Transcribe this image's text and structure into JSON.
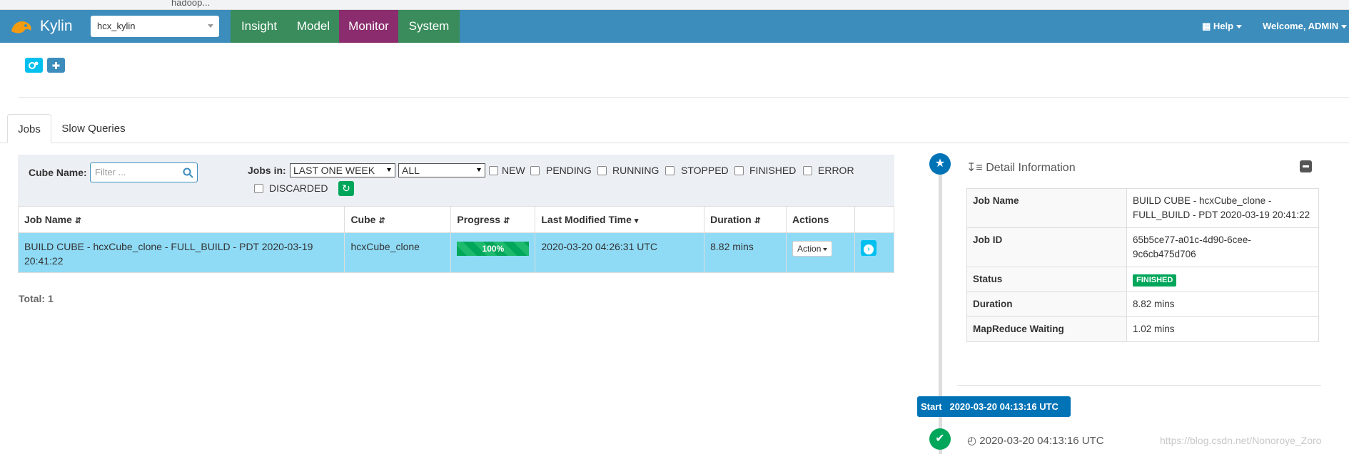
{
  "browser": {
    "address_fragment": "hadoop..."
  },
  "header": {
    "brand": "Kylin",
    "project": "hcx_kylin",
    "nav": [
      {
        "label": "Insight",
        "color": "#3a8c5c"
      },
      {
        "label": "Model",
        "color": "#3a8c5c"
      },
      {
        "label": "Monitor",
        "color": "#8b2c6e"
      },
      {
        "label": "System",
        "color": "#3a8c5c"
      }
    ],
    "help": "Help",
    "welcome": "Welcome, ADMIN"
  },
  "tabs": [
    "Jobs",
    "Slow Queries"
  ],
  "filters": {
    "cube_name_label": "Cube Name:",
    "cube_name_placeholder": "Filter ...",
    "jobs_in_label": "Jobs in:",
    "period": "LAST ONE WEEK",
    "scope": "ALL",
    "statuses": [
      "NEW",
      "PENDING",
      "RUNNING",
      "STOPPED",
      "FINISHED",
      "ERROR",
      "DISCARDED"
    ]
  },
  "table": {
    "columns": [
      "Job Name",
      "Cube",
      "Progress",
      "Last Modified Time",
      "Duration",
      "Actions"
    ],
    "rows": [
      {
        "job_name": "BUILD CUBE - hcxCube_clone - FULL_BUILD - PDT 2020-03-19 20:41:22",
        "cube": "hcxCube_clone",
        "progress": "100%",
        "last_modified": "2020-03-20 04:26:31 UTC",
        "duration": "8.82 mins",
        "action": "Action"
      }
    ],
    "total": "Total: 1"
  },
  "detail": {
    "title": "Detail Information",
    "rows": [
      {
        "key": "Job Name",
        "value": "BUILD CUBE - hcxCube_clone - FULL_BUILD - PDT 2020-03-19 20:41:22"
      },
      {
        "key": "Job ID",
        "value": "65b5ce77-a01c-4d90-6cee-9c6cb475d706"
      },
      {
        "key": "Status",
        "value": "FINISHED"
      },
      {
        "key": "Duration",
        "value": "8.82 mins"
      },
      {
        "key": "MapReduce Waiting",
        "value": "1.02 mins"
      }
    ]
  },
  "timeline": {
    "start_label": "Start",
    "start_time": "2020-03-20 04:13:16 UTC",
    "event_time": "2020-03-20 04:13:16 UTC"
  },
  "watermark": "https://blog.csdn.net/Nonoroye_Zoro"
}
